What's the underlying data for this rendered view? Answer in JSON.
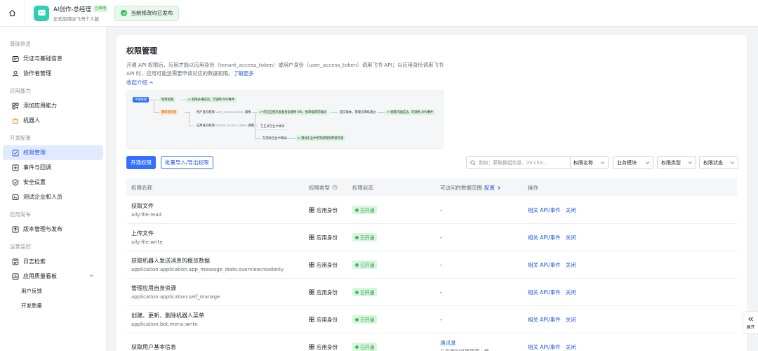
{
  "app": {
    "title": "AI创作-总经理",
    "badge": "已启用",
    "subtitle": "正式应用@飞书个人版",
    "logo_color": "#2fcfb5"
  },
  "toast": {
    "text": "当前修改均已发布"
  },
  "sidebar": {
    "sections": [
      {
        "title": "基础信息",
        "items": [
          {
            "label": "凭证与基础信息",
            "icon": "key-icon"
          },
          {
            "label": "协作者管理",
            "icon": "user-icon"
          }
        ]
      },
      {
        "title": "应用能力",
        "items": [
          {
            "label": "添加应用能力",
            "icon": "grid-plus-icon"
          },
          {
            "label": "机器人",
            "icon": "robot-icon"
          }
        ]
      },
      {
        "title": "开发配置",
        "items": [
          {
            "label": "权限管理",
            "icon": "permission-icon",
            "active": true
          },
          {
            "label": "事件与回调",
            "icon": "event-icon"
          },
          {
            "label": "安全设置",
            "icon": "shield-icon"
          },
          {
            "label": "测试企业和人员",
            "icon": "test-icon"
          }
        ]
      },
      {
        "title": "应用发布",
        "items": [
          {
            "label": "版本管理与发布",
            "icon": "version-icon"
          }
        ]
      },
      {
        "title": "运营监控",
        "items": [
          {
            "label": "日志检索",
            "icon": "log-icon"
          },
          {
            "label": "应用质量看板",
            "icon": "dashboard-icon",
            "expanded": true,
            "children": [
              "用户反馈",
              "开发质量"
            ]
          }
        ]
      }
    ]
  },
  "page": {
    "title": "权限管理",
    "desc": "开通 API 权限后，应用才能以应用身份（tenant_access_token）或用户身份（user_access_token）调用飞书 API；以应用身份调用飞书 API 时，应用可能还需要申请对应的数据权限。",
    "learn_more": "了解更多",
    "collapse": "收起介绍"
  },
  "flow": {
    "apply": "申请权限",
    "no_review": "免审权限",
    "no_review_result": "权限开通成功，可调用 API/事件",
    "review": "需审核权限",
    "user_perm": "用户身份权限",
    "user_token": "user_access_token",
    "call": "调用",
    "step_test": "仅在应用开发者身份调用 API，免审核即可调试",
    "step_submit": "提交版本，管理员审核通过",
    "step_result": "权限开通成功，可调用 API/事件",
    "app_perm": "应用身份权限",
    "app_token": "tenant_access_token",
    "in_enterprise": "在正式企业中调试",
    "in_test": "在测试企业中调试",
    "test_result": "测试企业中所有权限免审核开通"
  },
  "toolbar": {
    "enable": "开通权限",
    "batch": "批量导入/导出权限",
    "search_placeholder": "例如：获取群组信息、im:cha...",
    "search_scope": "权限名称",
    "filters": [
      "业务模块",
      "权限类型",
      "权限状态"
    ]
  },
  "table": {
    "headers": {
      "name": "权限名称",
      "type": "权限类型",
      "status": "权限状态",
      "scope": "可访问的数据范围",
      "config": "配置",
      "ops": "操作"
    },
    "rows": [
      {
        "name": "获取文件",
        "code": "aily:file:read",
        "type": "应用身份",
        "status": "已开通",
        "scope": "-",
        "op1": "相关 API/事件",
        "op2": "关闭"
      },
      {
        "name": "上传文件",
        "code": "aily:file:write",
        "type": "应用身份",
        "status": "已开通",
        "scope": "-",
        "op1": "相关 API/事件",
        "op2": "关闭"
      },
      {
        "name": "获取机器人发送消息的概览数据",
        "code": "application:application.app_message_stats.overview:readonly",
        "type": "应用身份",
        "status": "已开通",
        "scope": "-",
        "op1": "相关 API/事件",
        "op2": "关闭"
      },
      {
        "name": "管理应用自身资源",
        "code": "application:application:self_manage",
        "type": "应用身份",
        "status": "已开通",
        "scope": "-",
        "op1": "相关 API/事件",
        "op2": "关闭"
      },
      {
        "name": "创建、更新、删除机器人菜单",
        "code": "application:bot.menu:write",
        "type": "应用身份",
        "status": "已开通",
        "scope": "-",
        "op1": "相关 API/事件",
        "op2": "关闭"
      },
      {
        "name": "获取用户基本信息",
        "code": "",
        "type": "应用身份",
        "status": "已开通",
        "scope": "通讯录",
        "scope_extra": "与应用的可用范围一致",
        "op1": "相关 API/事件",
        "op2": "关闭"
      }
    ]
  },
  "expand_tab": {
    "label": "展开"
  }
}
